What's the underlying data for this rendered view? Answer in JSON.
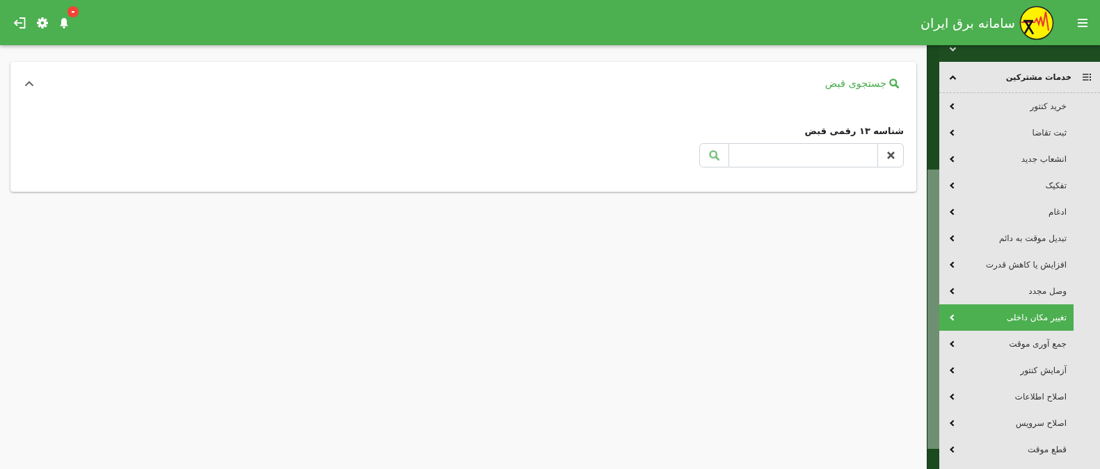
{
  "header": {
    "title": "سامانه برق ایران",
    "notifications": {
      "unread": true
    }
  },
  "sidebar": {
    "sections": [
      {
        "expanded": false
      },
      {
        "title": "خدمات مشترکین",
        "expanded": true,
        "items": [
          {
            "label": "خرید کنتور",
            "selected": false
          },
          {
            "label": "ثبت تقاضا",
            "selected": false
          },
          {
            "label": "انشعاب جدید",
            "selected": false
          },
          {
            "label": "تفکیک",
            "selected": false
          },
          {
            "label": "ادغام",
            "selected": false
          },
          {
            "label": "تبدیل موقت به دائم",
            "selected": false
          },
          {
            "label": "افزایش یا کاهش قدرت",
            "selected": false
          },
          {
            "label": "وصل مجدد",
            "selected": false
          },
          {
            "label": "تغییر مکان داخلی",
            "selected": true
          },
          {
            "label": "جمع آوری موقت",
            "selected": false
          },
          {
            "label": "آزمایش کنتور",
            "selected": false
          },
          {
            "label": "اصلاح اطلاعات",
            "selected": false
          },
          {
            "label": "اصلاح سرویس",
            "selected": false
          },
          {
            "label": "قطع موقت",
            "selected": false
          }
        ]
      }
    ]
  },
  "search_card": {
    "title": "جستجوی قبض",
    "expanded": true,
    "field": {
      "label": "شناسه ۱۳ رقمی قبض"
    }
  }
}
